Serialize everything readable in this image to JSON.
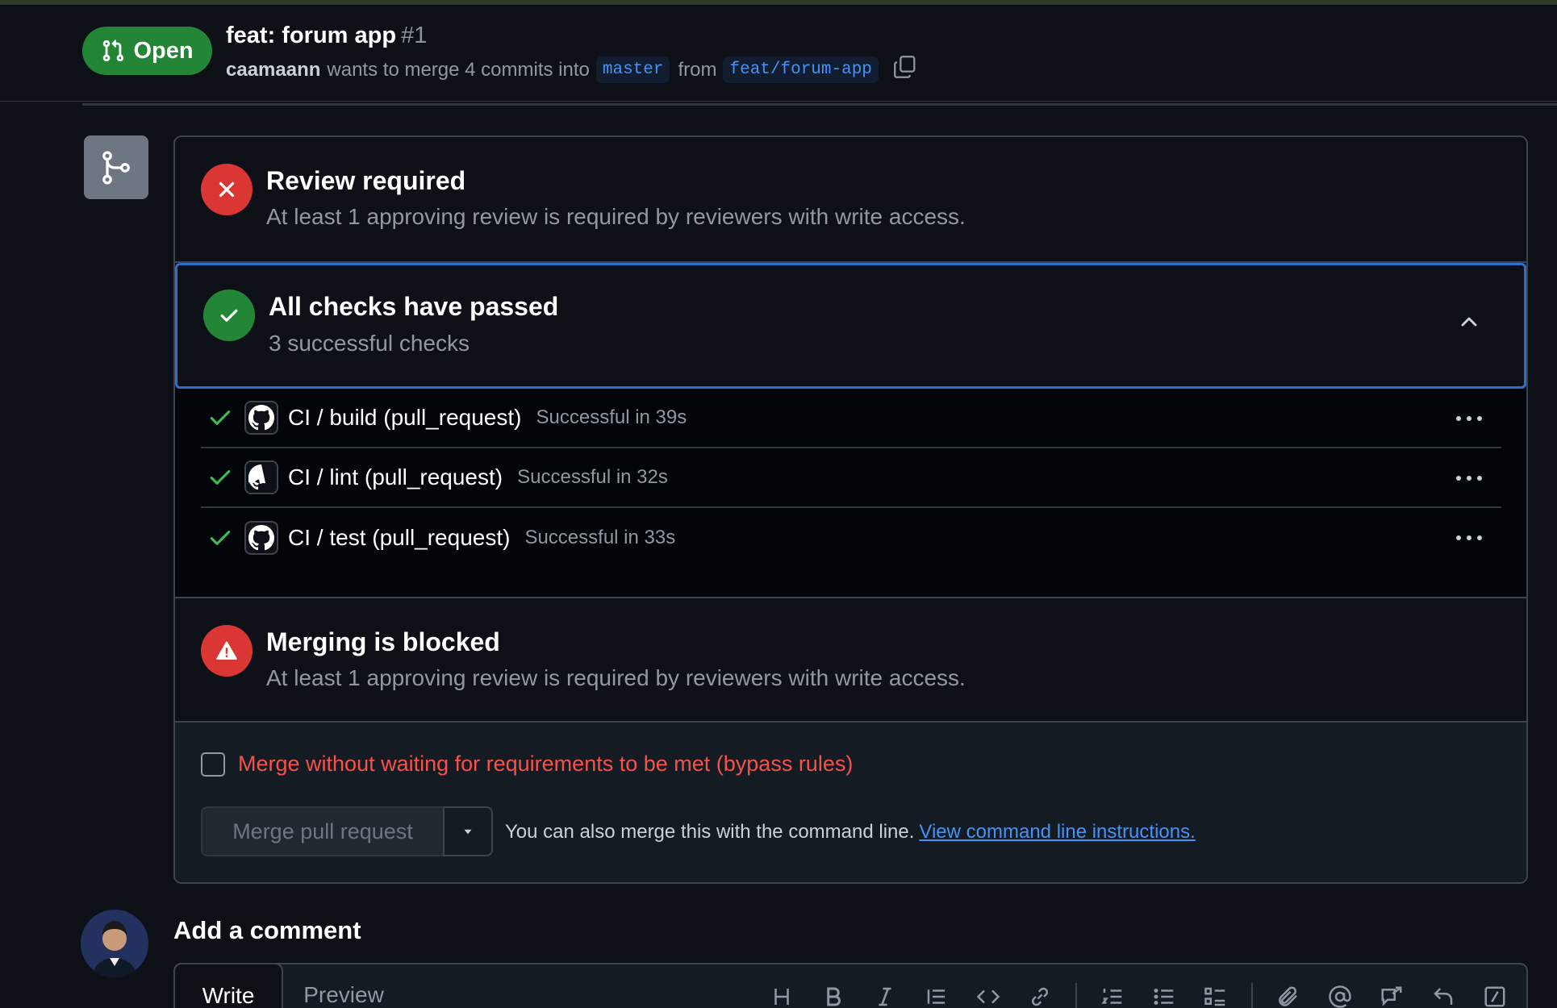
{
  "pr": {
    "state": "Open",
    "title": "feat: forum app",
    "number": "#1",
    "author": "caamaann",
    "merge_text": "wants to merge 4 commits into",
    "base_branch": "master",
    "from_text": "from",
    "head_branch": "feat/forum-app"
  },
  "review": {
    "title": "Review required",
    "description": "At least 1 approving review is required by reviewers with write access."
  },
  "checks": {
    "title": "All checks have passed",
    "summary": "3 successful checks",
    "items": [
      {
        "name": "CI / build (pull_request)",
        "duration": "Successful in 39s"
      },
      {
        "name": "CI / lint (pull_request)",
        "duration": "Successful in 32s"
      },
      {
        "name": "CI / test (pull_request)",
        "duration": "Successful in 33s"
      }
    ]
  },
  "blocked": {
    "title": "Merging is blocked",
    "description": "At least 1 approving review is required by reviewers with write access."
  },
  "actions": {
    "bypass_label": "Merge without waiting for requirements to be met (bypass rules)",
    "merge_button": "Merge pull request",
    "cli_text": "You can also merge this with the command line.",
    "cli_link": "View command line instructions."
  },
  "comment": {
    "heading": "Add a comment",
    "tabs": {
      "write": "Write",
      "preview": "Preview"
    },
    "toolbar": [
      "heading-icon",
      "bold-icon",
      "italic-icon",
      "quote-icon",
      "code-icon",
      "link-icon",
      "ordered-list-icon",
      "unordered-list-icon",
      "task-list-icon",
      "attach-icon",
      "mention-icon",
      "reference-icon",
      "reply-icon",
      "slash-command-icon"
    ]
  },
  "colors": {
    "open_green": "#238636",
    "danger_red": "#da3633",
    "focus_blue": "#316dca",
    "link_blue": "#4493f8",
    "bypass_red": "#f85149"
  }
}
